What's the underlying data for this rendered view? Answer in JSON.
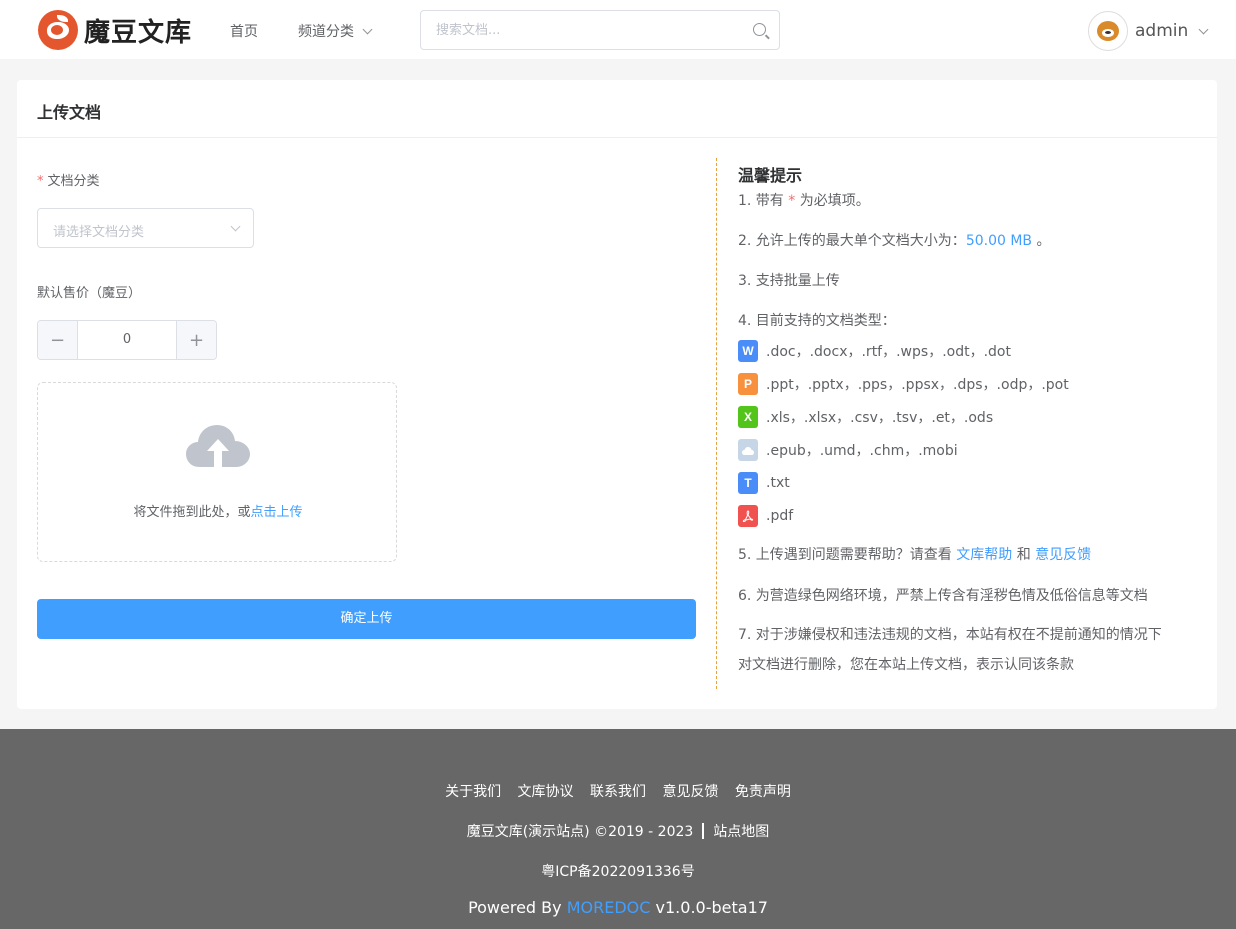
{
  "header": {
    "logo_text": "魔豆文库",
    "nav": {
      "home": "首页",
      "channel": "频道分类"
    },
    "search_placeholder": "搜索文档...",
    "username": "admin"
  },
  "upload": {
    "title": "上传文档",
    "category_required_mark": "*",
    "category_label": "文档分类",
    "category_placeholder": "请选择文档分类",
    "price_label": "默认售价（魔豆）",
    "price_value": "0",
    "minus": "−",
    "plus": "+",
    "drop_text": "将文件拖到此处，或",
    "drop_link": "点击上传",
    "submit": "确定上传"
  },
  "tips": {
    "title": "温馨提示",
    "t1_pre": "1. 带有",
    "t1_mark": "*",
    "t1_post": "为必填项。",
    "t2_pre": "2. 允许上传的最大单个文档大小为：",
    "t2_size": "50.00 MB",
    "t2_post": "。",
    "t3": "3. 支持批量上传",
    "t4": "4. 目前支持的文档类型：",
    "types": {
      "word": ".doc，.docx，.rtf，.wps，.odt，.dot",
      "ppt": ".ppt，.pptx，.pps，.ppsx，.dps，.odp，.pot",
      "excel": ".xls，.xlsx，.csv，.tsv，.et，.ods",
      "ebook": ".epub，.umd，.chm，.mobi",
      "txt": ".txt",
      "pdf": ".pdf"
    },
    "icon_letters": {
      "word": "W",
      "ppt": "P",
      "excel": "X",
      "txt": "T"
    },
    "t5_pre": "5. 上传遇到问题需要帮助？请查看",
    "t5_link1": "文库帮助",
    "t5_and": "和",
    "t5_link2": "意见反馈",
    "t6": "6. 为营造绿色网络环境，严禁上传含有淫秽色情及低俗信息等文档",
    "t7_line1": "7. 对于涉嫌侵权和违法违规的文档，本站有权在不提前通知的情况下",
    "t7_line2": "对文档进行删除，您在本站上传文档，表示认同该条款"
  },
  "footer": {
    "links": [
      "关于我们",
      "文库协议",
      "联系我们",
      "意见反馈",
      "免责声明"
    ],
    "copyright": "魔豆文库(演示站点) ©2019 - 2023",
    "sitemap": "站点地图",
    "icp": "粤ICP备2022091336号",
    "powered_by": "Powered By",
    "brand": "MOREDOC",
    "version": "v1.0.0-beta17"
  },
  "colors": {
    "primary": "#409eff",
    "required": "#f56c6c",
    "word": "#4a8df8",
    "ppt": "#f7913d",
    "excel": "#52c41a",
    "ebook": "#c6d6e6",
    "txt": "#4a8df8",
    "pdf": "#f0524f",
    "footer_bg": "#676767"
  }
}
